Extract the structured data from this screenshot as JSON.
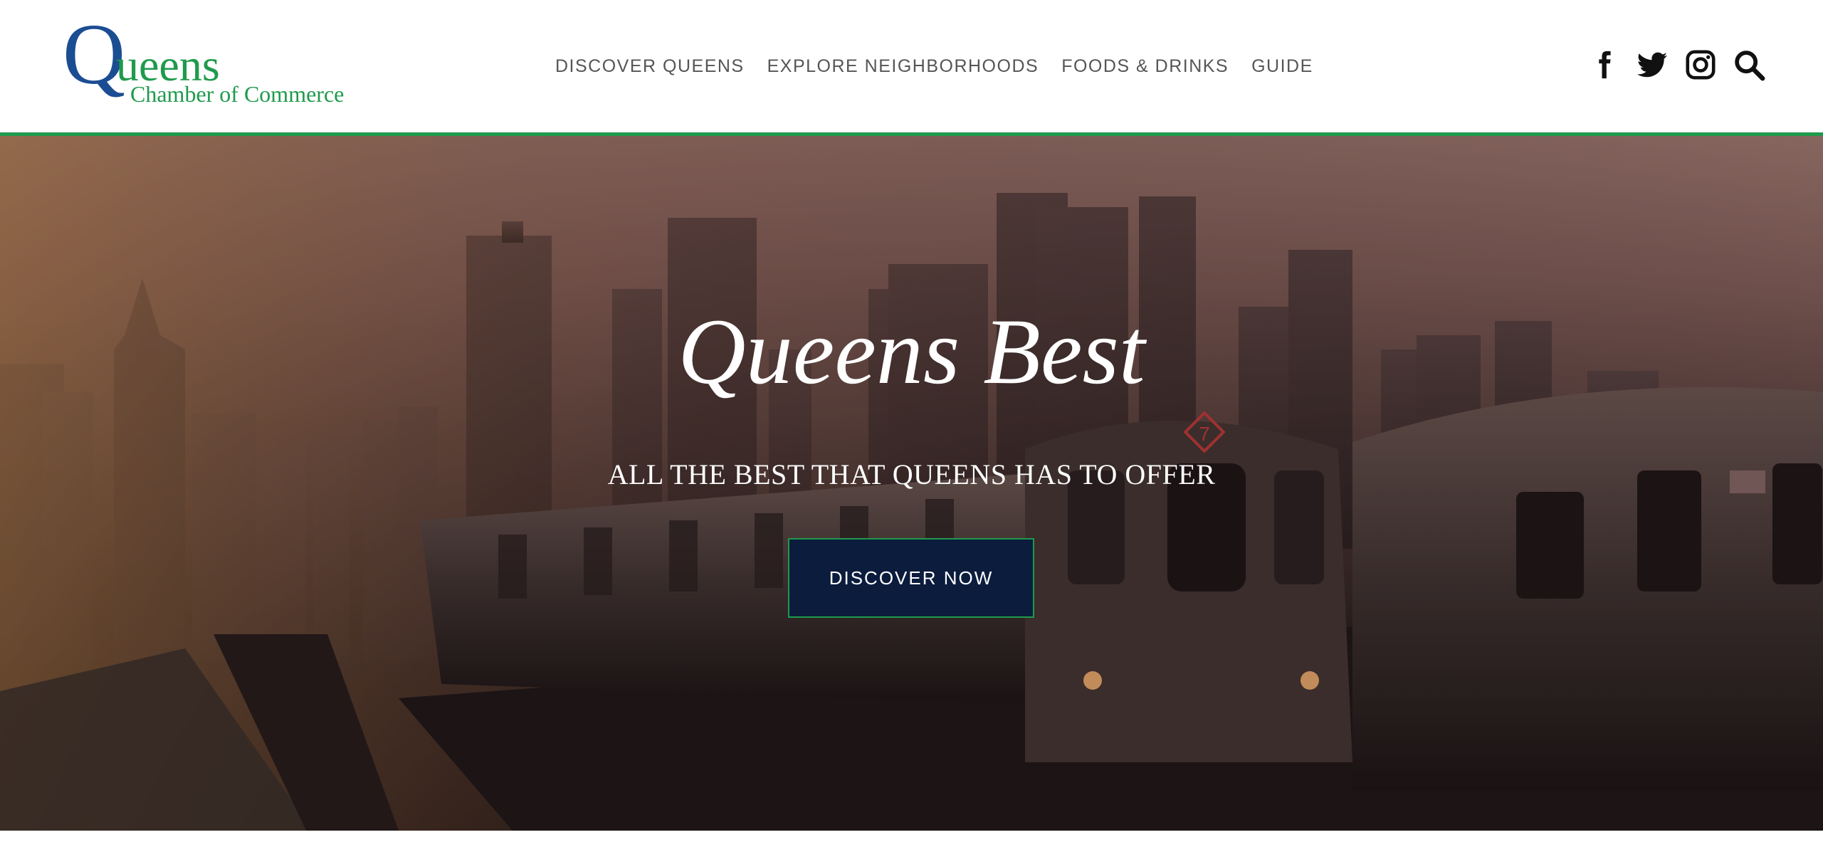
{
  "logo": {
    "q": "Q",
    "ueens": "ueens",
    "subtitle": "Chamber of Commerce"
  },
  "nav": {
    "items": [
      {
        "label": "DISCOVER QUEENS"
      },
      {
        "label": "EXPLORE NEIGHBORHOODS"
      },
      {
        "label": "FOODS & DRINKS"
      },
      {
        "label": "GUIDE"
      }
    ]
  },
  "social": {
    "icons": [
      "facebook-icon",
      "twitter-icon",
      "instagram-icon",
      "search-icon"
    ]
  },
  "hero": {
    "title": "Queens Best",
    "subtitle": "ALL THE BEST THAT QUEENS HAS TO OFFER",
    "cta_label": "DISCOVER NOW",
    "train_badge": "7"
  },
  "colors": {
    "brand_blue": "#1b4d93",
    "brand_green": "#1f9a4c",
    "cta_background": "#0b1c3d",
    "nav_text": "#555555"
  }
}
